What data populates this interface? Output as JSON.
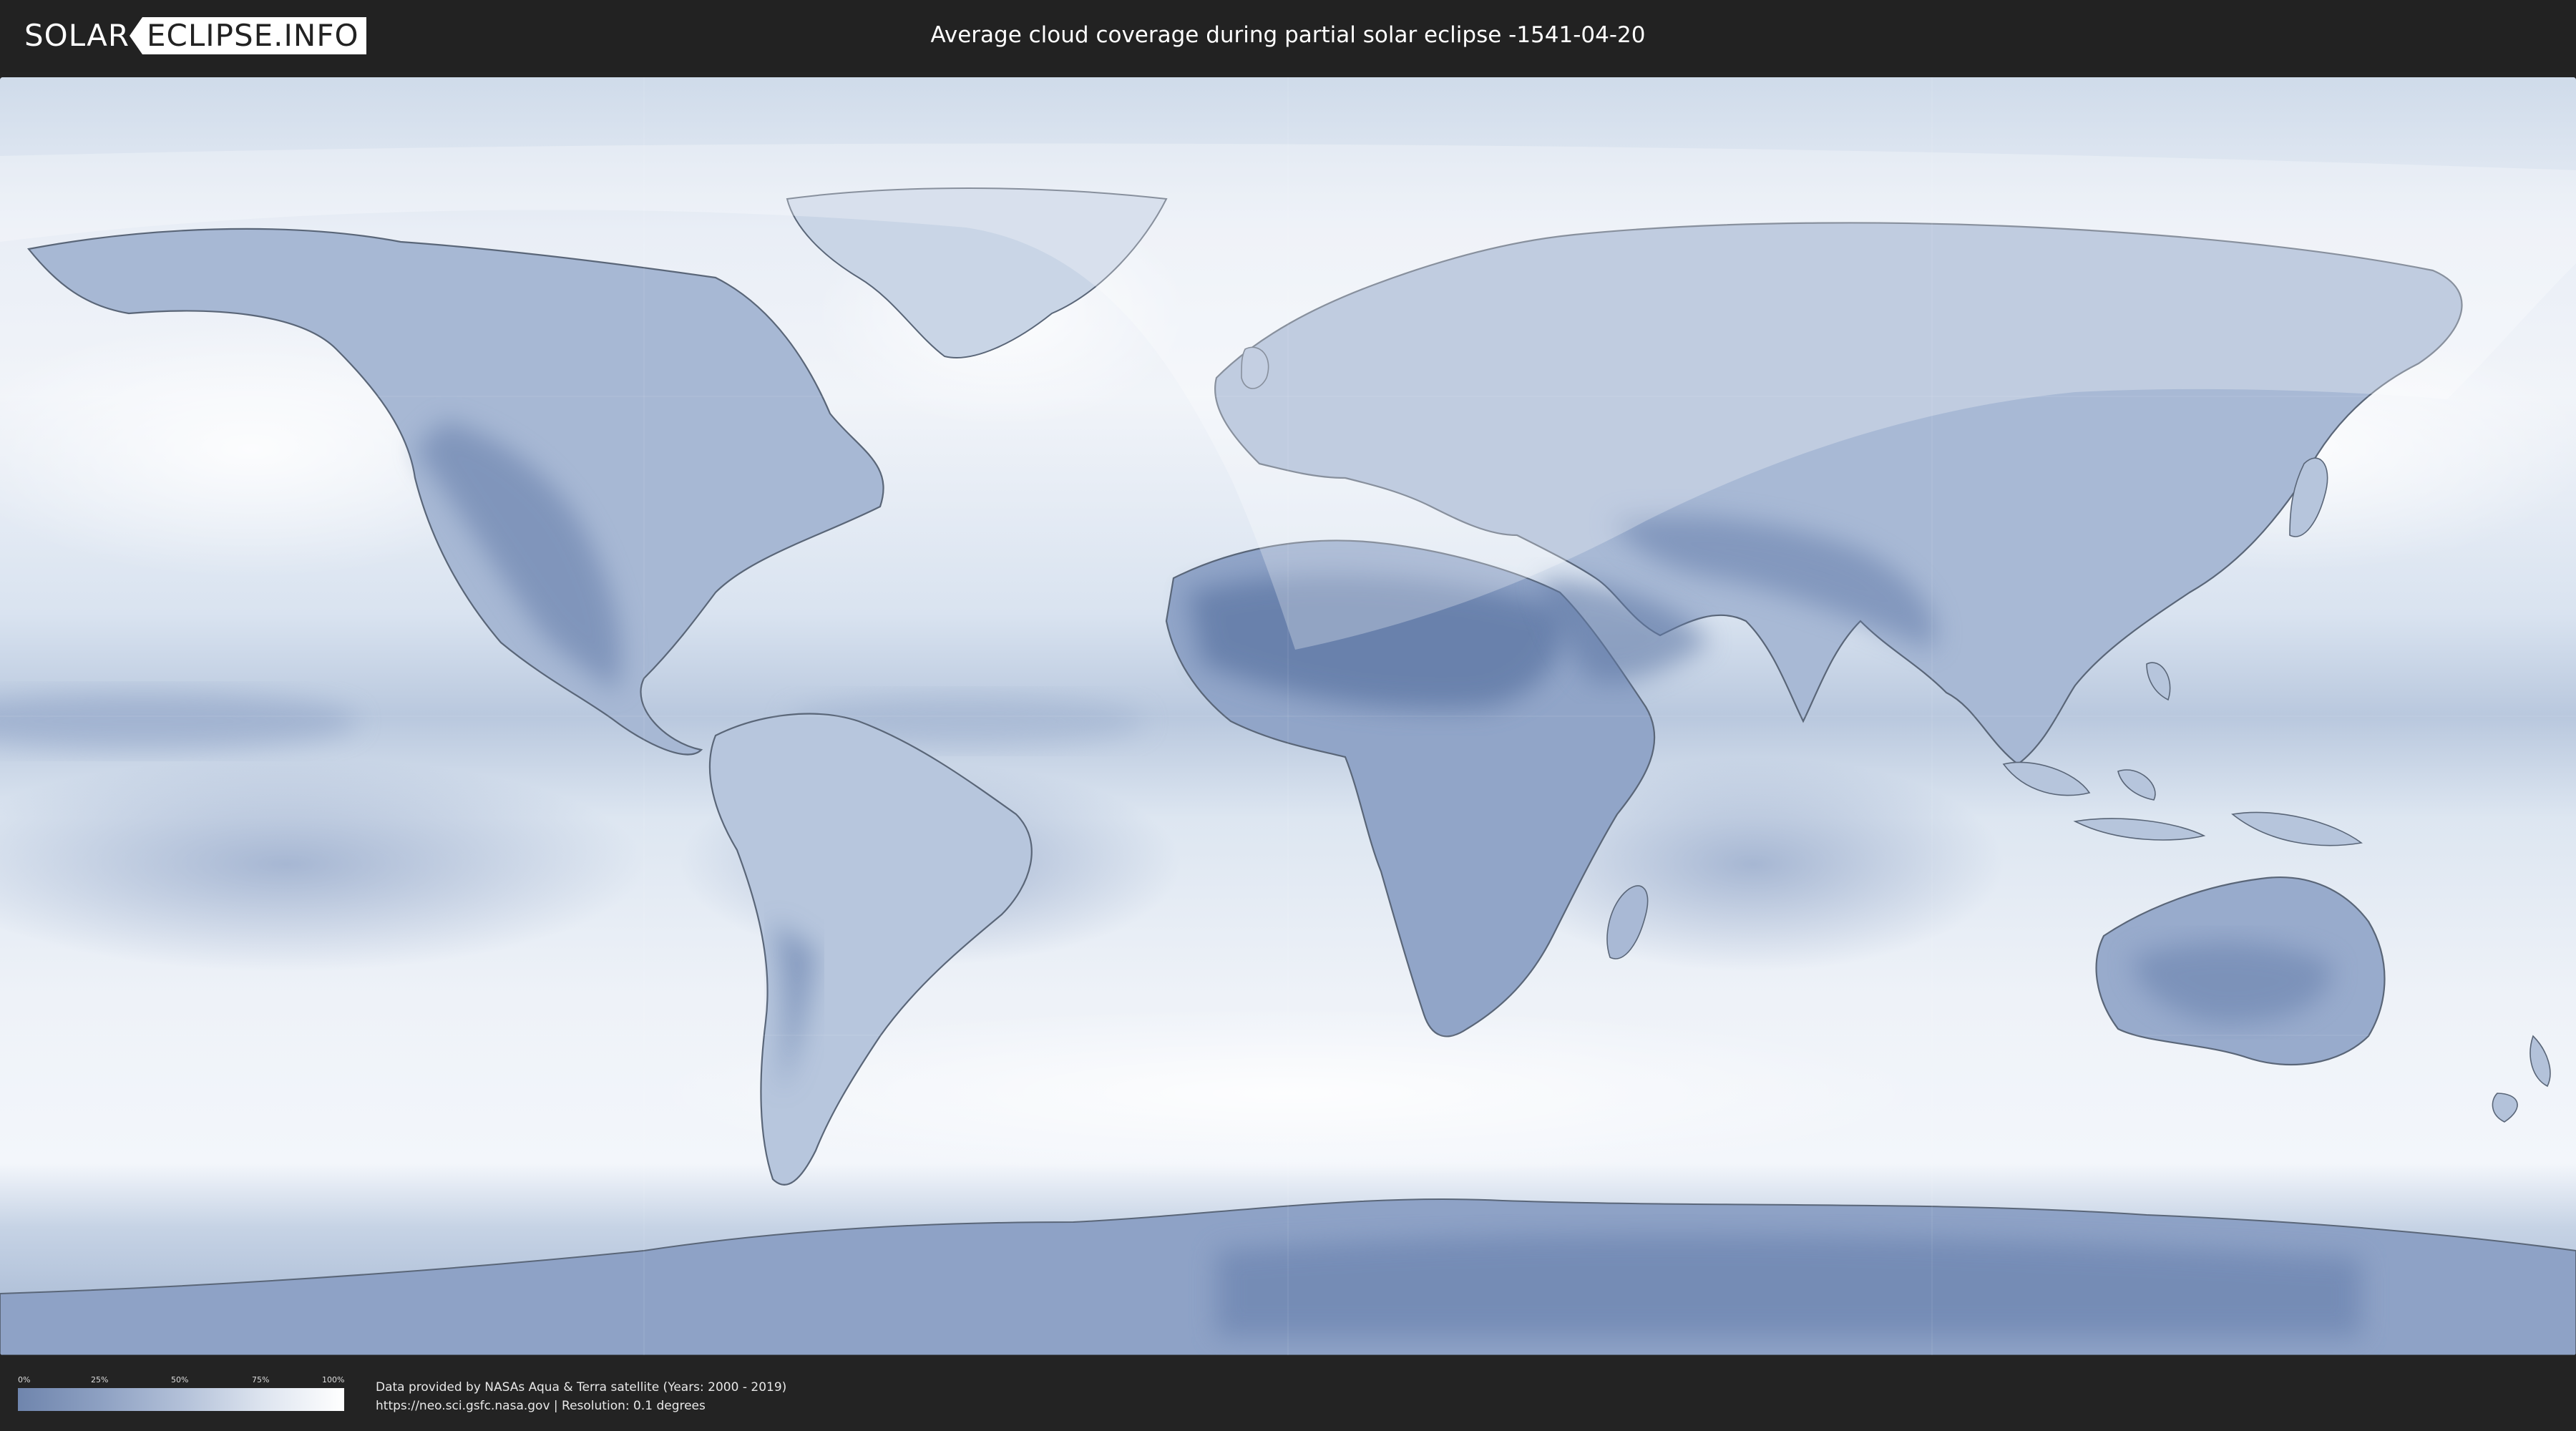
{
  "header": {
    "logo": {
      "left_text": "SOLAR",
      "right_text": "ECLIPSE.INFO"
    },
    "title": "Average cloud coverage during partial solar eclipse -1541-04-20"
  },
  "map": {
    "colors": {
      "ocean_clear": "#7f95bd",
      "cloudy": "#f2f5fa",
      "land_clear": "#647aa5",
      "border": "#5a6678",
      "eclipse_overlay": "#ffffff"
    }
  },
  "legend": {
    "ticks": [
      "0%",
      "25%",
      "50%",
      "75%",
      "100%"
    ],
    "colors": [
      "#6f85ad",
      "#8da0c2",
      "#b2c0d8",
      "#dde4ef",
      "#ffffff"
    ]
  },
  "footer": {
    "source_line": "Data provided by NASAs Aqua & Terra satellite (Years: 2000 - 2019)",
    "info_line": "https://neo.sci.gsfc.nasa.gov | Resolution: 0.1 degrees"
  }
}
